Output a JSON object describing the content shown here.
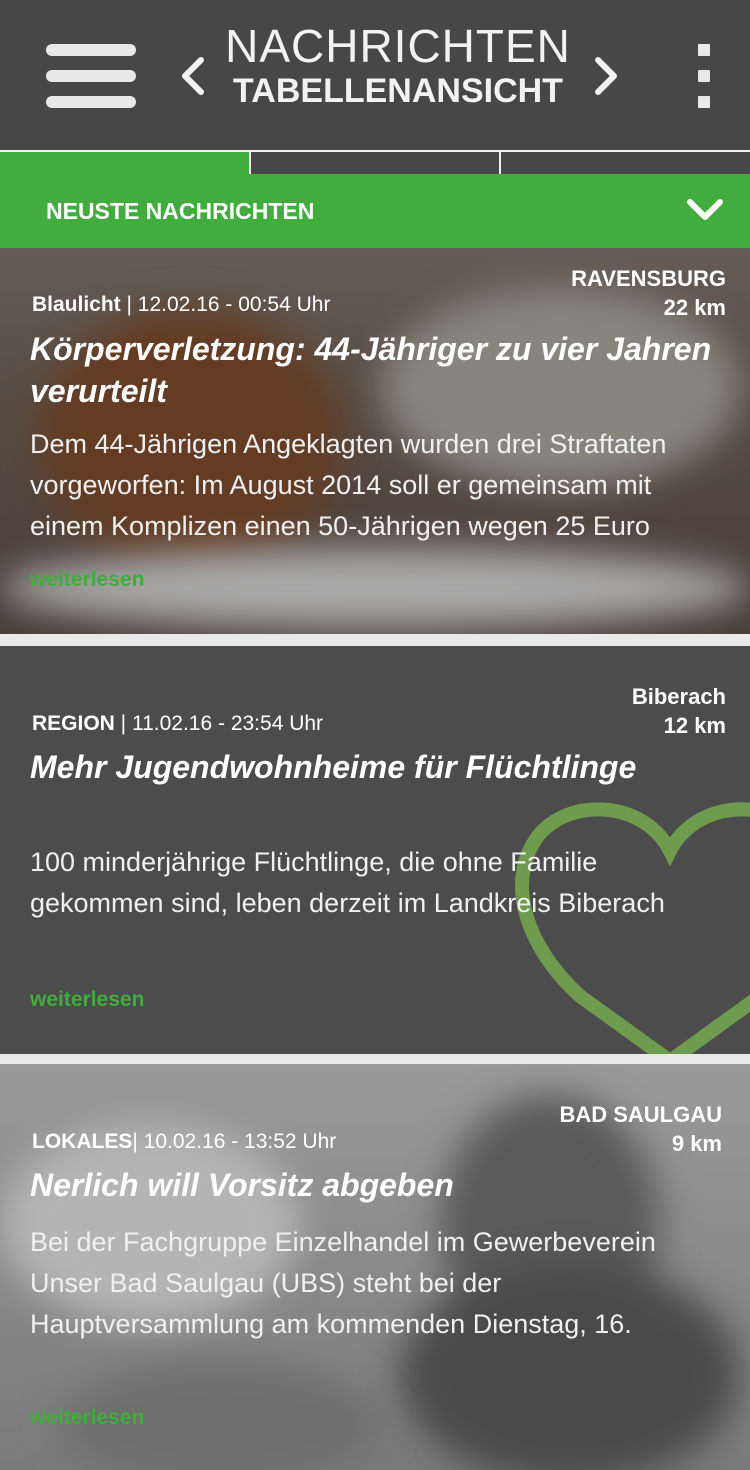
{
  "header": {
    "title": "NACHRICHTEN",
    "subtitle": "TABELLENANSICHT"
  },
  "section": {
    "label": "NEUSTE NACHRICHTEN"
  },
  "articles": [
    {
      "location": "RAVENSBURG",
      "distance": "22 km",
      "category": "Blaulicht",
      "date": " | 12.02.16 - 00:54 Uhr",
      "headline": "Körperverletzung: 44-Jähriger zu vier Jahren verurteilt",
      "teaser": "Dem 44-Jährigen Angeklagten wurden drei Straftaten vorgeworfen: Im August 2014 soll er gemeinsam mit einem Komplizen einen 50-Jährigen wegen 25 Euro",
      "readmore": "weiterlesen"
    },
    {
      "location": "Biberach",
      "distance": "12 km",
      "category": "REGION",
      "date": " | 11.02.16 - 23:54 Uhr",
      "headline": "Mehr Jugendwohnheime für Flüchtlinge",
      "teaser": "100 minderjährige Flüchtlinge, die ohne Familie gekommen sind, leben derzeit im Landkreis Biberach",
      "readmore": "weiterlesen"
    },
    {
      "location": "BAD SAULGAU",
      "distance": "9 km",
      "category": "LOKALES",
      "date": "| 10.02.16 - 13:52 Uhr",
      "headline": "Nerlich will Vorsitz abgeben",
      "teaser": "Bei der Fachgruppe Einzelhandel im Gewerbeverein Unser Bad Saulgau (UBS) steht bei der Hauptversammlung am kommenden Dienstag, 16.",
      "readmore": "weiterlesen"
    }
  ],
  "colors": {
    "accent": "#40ad3e",
    "header_bg": "#474747"
  },
  "icons": [
    "menu-icon",
    "chevron-left-icon",
    "chevron-right-icon",
    "more-vertical-icon",
    "chevron-down-icon",
    "heart-icon"
  ]
}
